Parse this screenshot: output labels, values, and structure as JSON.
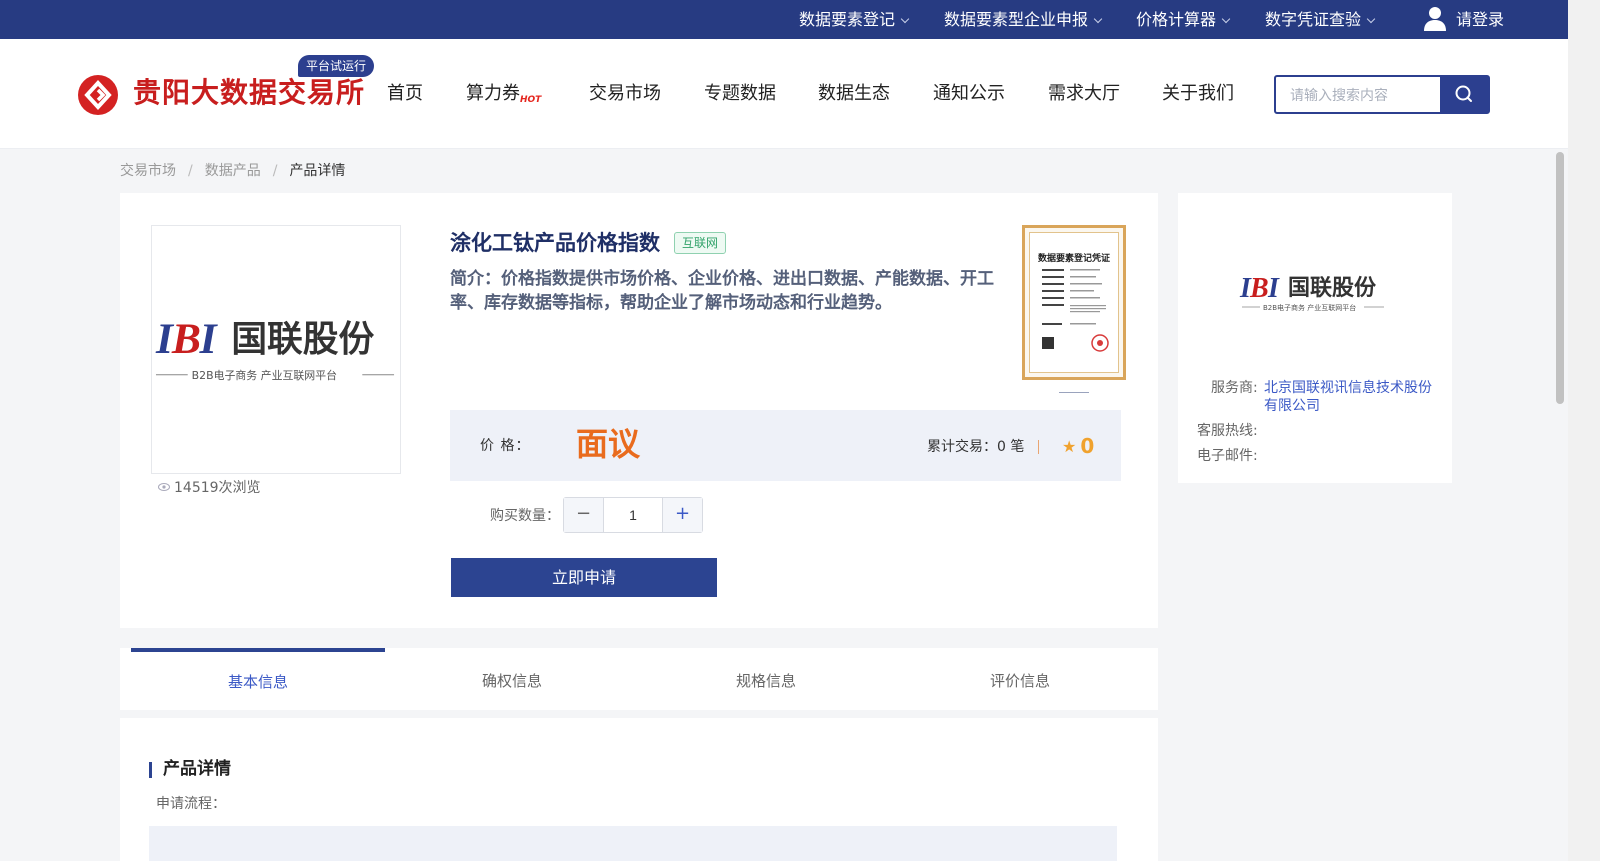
{
  "topbar": {
    "links": [
      "数据要素登记",
      "数据要素型企业申报",
      "价格计算器",
      "数字凭证查验"
    ],
    "login": "请登录"
  },
  "header": {
    "logo_text": "贵阳大数据交易所",
    "badge": "平台试运行",
    "nav": [
      "首页",
      "算力券",
      "交易市场",
      "专题数据",
      "数据生态",
      "通知公示",
      "需求大厅",
      "关于我们"
    ],
    "hot_label": "HOT",
    "search_placeholder": "请输入搜索内容"
  },
  "breadcrumb": [
    "交易市场",
    "数据产品",
    "产品详情"
  ],
  "product": {
    "logo_brand": "国联股份",
    "logo_sub": "B2B电子商务 产业互联网平台",
    "views": "14519次浏览",
    "title": "涂化工钛产品价格指数",
    "tag": "互联网",
    "intro": "简介：价格指数提供市场价格、企业价格、进出口数据、产能数据、开工率、库存数据等指标，帮助企业了解市场动态和行业趋势。",
    "cert_title": "数据要素登记凭证",
    "price_label": "价 格：",
    "price_value": "面议",
    "trades": "累计交易：0 笔",
    "rating": "0",
    "qty_label": "购买数量：",
    "qty_value": "1",
    "apply": "立即申请"
  },
  "provider": {
    "logo_brand": "国联股份",
    "logo_sub": "B2B电子商务 产业互联网平台",
    "service_key": "服务商:",
    "service_val": "北京国联视讯信息技术股份有限公司",
    "hotline_key": "客服热线:",
    "email_key": "电子邮件:"
  },
  "tabs": [
    "基本信息",
    "确权信息",
    "规格信息",
    "评价信息"
  ],
  "detail": {
    "title": "产品详情",
    "flow_label": "申请流程："
  },
  "colors": {
    "topbar": "#273b82",
    "brand_red": "#c81e1e",
    "accent_blue": "#2c4491",
    "price_orange": "#e96b1d"
  }
}
